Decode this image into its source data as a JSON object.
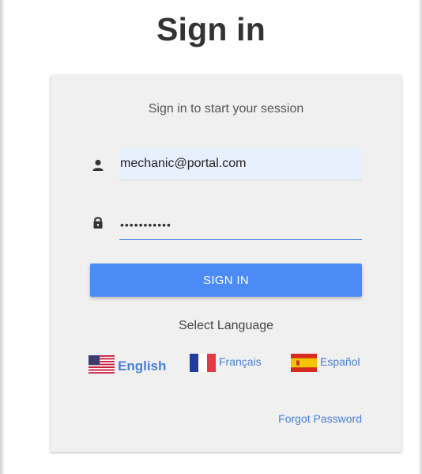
{
  "page": {
    "title": "Sign in"
  },
  "login": {
    "subtitle": "Sign in to start your session",
    "email_value": "mechanic@portal.com",
    "password_value": "•••••••••••",
    "signin_label": "SIGN IN"
  },
  "language": {
    "label": "Select Language",
    "options": [
      {
        "label": "English",
        "flag": "us-flag-icon",
        "selected": true
      },
      {
        "label": "Français",
        "flag": "fr-flag-icon",
        "selected": false
      },
      {
        "label": "Español",
        "flag": "es-flag-icon",
        "selected": false
      }
    ]
  },
  "links": {
    "forgot_password": "Forgot Password"
  },
  "colors": {
    "primary": "#4c8bf5",
    "link": "#4a7fd6",
    "card_bg": "#f0f0f0",
    "autofill_bg": "#e8f0fe"
  }
}
